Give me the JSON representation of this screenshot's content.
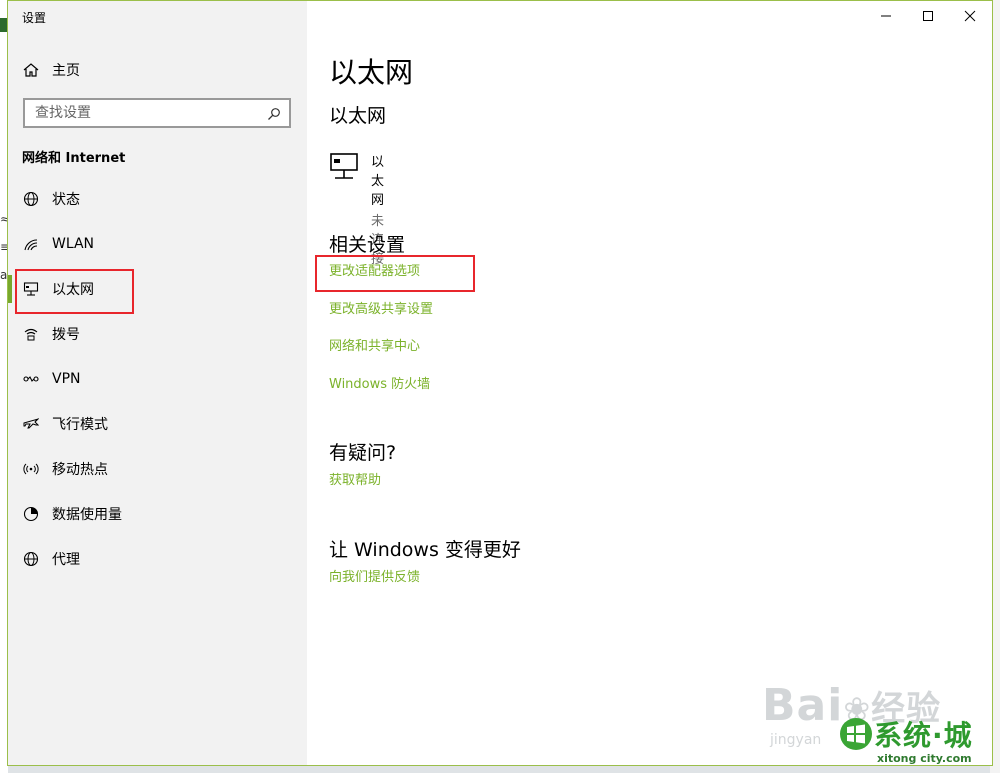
{
  "window": {
    "title": "设置"
  },
  "sidebar": {
    "home_label": "主页",
    "search_placeholder": "查找设置",
    "section_title": "网络和 Internet",
    "items": [
      {
        "label": "状态",
        "icon": "globe-status-icon"
      },
      {
        "label": "WLAN",
        "icon": "wifi-icon"
      },
      {
        "label": "以太网",
        "icon": "ethernet-icon",
        "active": true
      },
      {
        "label": "拨号",
        "icon": "dialup-icon"
      },
      {
        "label": "VPN",
        "icon": "vpn-icon"
      },
      {
        "label": "飞行模式",
        "icon": "airplane-icon"
      },
      {
        "label": "移动热点",
        "icon": "hotspot-icon"
      },
      {
        "label": "数据使用量",
        "icon": "data-usage-icon"
      },
      {
        "label": "代理",
        "icon": "globe-proxy-icon"
      }
    ]
  },
  "main": {
    "page_title": "以太网",
    "ethernet_heading": "以太网",
    "adapter": {
      "name": "以太网",
      "status": "未连接"
    },
    "related_title": "相关设置",
    "related_links": [
      "更改适配器选项",
      "更改高级共享设置",
      "网络和共享中心",
      "Windows 防火墙"
    ],
    "question_title": "有疑问?",
    "help_link": "获取帮助",
    "improve_title": "让 Windows 变得更好",
    "feedback_link": "向我们提供反馈"
  },
  "watermark": {
    "baidu": "Bai",
    "baidu2": "经验",
    "jingyan": "jingyan",
    "site_logo": "系统·城",
    "site_url": "xitong city.com"
  },
  "colors": {
    "accent": "#78a82c",
    "link": "#7bb22a",
    "highlight_box": "#e8262c",
    "window_border": "#9bbf4a"
  }
}
